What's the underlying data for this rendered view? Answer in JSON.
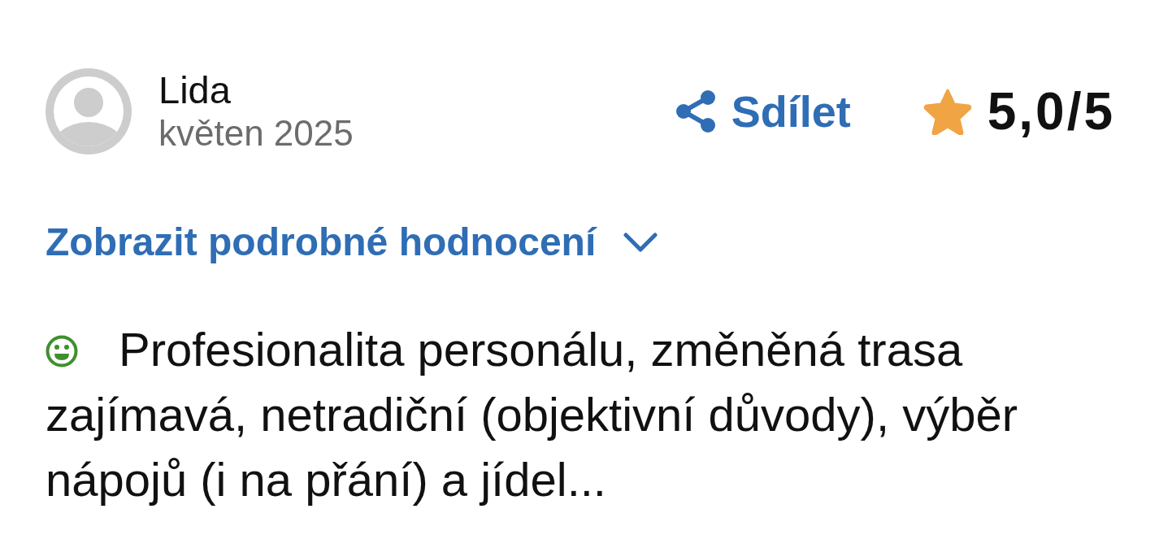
{
  "review": {
    "author": {
      "name": "Lida",
      "date": "květen 2025"
    },
    "share": {
      "label": "Sdílet"
    },
    "rating": {
      "text": "5,0/5"
    },
    "details_toggle": {
      "label": "Zobrazit podrobné hodnocení",
      "expanded": false
    },
    "comment": {
      "kind": "positive",
      "text": "Profesionalita personálu, změněná trasa zajímavá, netradiční (objektivní důvody), výběr nápojů (i na přání) a jídel..."
    }
  }
}
